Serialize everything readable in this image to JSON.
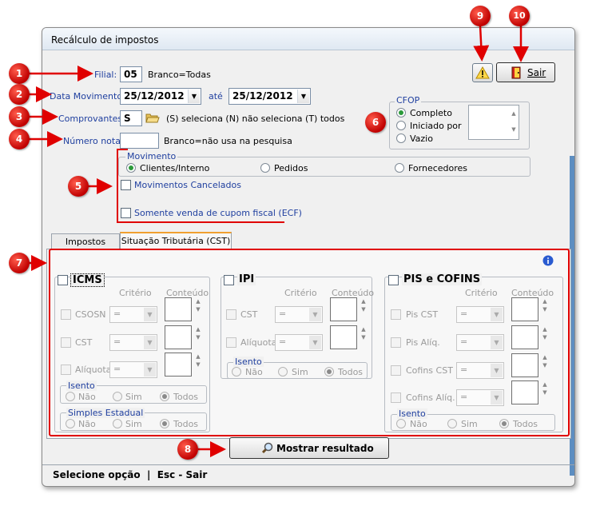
{
  "window": {
    "title": "Recálculo de impostos"
  },
  "filter": {
    "filial_label": "Filial:",
    "filial_value": "05",
    "filial_hint": "Branco=Todas",
    "data_label": "Data Movimento:",
    "data_from": "25/12/2012",
    "ate_label": "até",
    "data_to": "25/12/2012",
    "comprovantes_label": "Comprovantes:",
    "comprovantes_value": "S",
    "comprovantes_hint": "(S) seleciona  (N) não seleciona  (T) todos",
    "numero_label": "Número nota:",
    "numero_value": "",
    "numero_hint": "Branco=não usa na pesquisa"
  },
  "cfop": {
    "title": "CFOP",
    "options": [
      "Completo",
      "Iniciado por",
      "Vazio"
    ],
    "selected": "Completo"
  },
  "movimento": {
    "title": "Movimento",
    "options": [
      "Clientes/Interno",
      "Pedidos",
      "Fornecedores"
    ],
    "selected": "Clientes/Interno",
    "cancelados_label": "Movimentos Cancelados",
    "ecf_label": "Somente venda de cupom fiscal (ECF)"
  },
  "buttons": {
    "sair": "Sair",
    "mostrar": "Mostrar resultado"
  },
  "tabs": [
    {
      "label": "Impostos",
      "active": false
    },
    {
      "label": "Situação Tributária (CST)",
      "active": true
    }
  ],
  "cst": {
    "criterio_header": "Critério",
    "conteudo_header": "Conteúdo",
    "operator": "=",
    "icms": {
      "title": "ICMS",
      "rows": [
        "CSOSN",
        "CST",
        "Alíquota"
      ],
      "isento_title": "Isento",
      "simples_title": "Simples Estadual"
    },
    "ipi": {
      "title": "IPI",
      "rows": [
        "CST",
        "Alíquota"
      ],
      "isento_title": "Isento"
    },
    "pis": {
      "title": "PIS e COFINS",
      "rows": [
        "Pis CST",
        "Pis Alíq.",
        "Cofins CST",
        "Cofins Alíq."
      ],
      "isento_title": "Isento"
    },
    "radio_options": [
      "Não",
      "Sim",
      "Todos"
    ],
    "radio_selected": "Todos"
  },
  "badges": [
    "1",
    "2",
    "3",
    "4",
    "5",
    "6",
    "7",
    "8",
    "9",
    "10"
  ],
  "status": {
    "text": "Selecione opção  |  Esc - Sair"
  },
  "colors": {
    "badge": "#d40000",
    "arrow": "#e00000",
    "highlight": "#e00000",
    "accent_blue": "#1f3f9f"
  }
}
